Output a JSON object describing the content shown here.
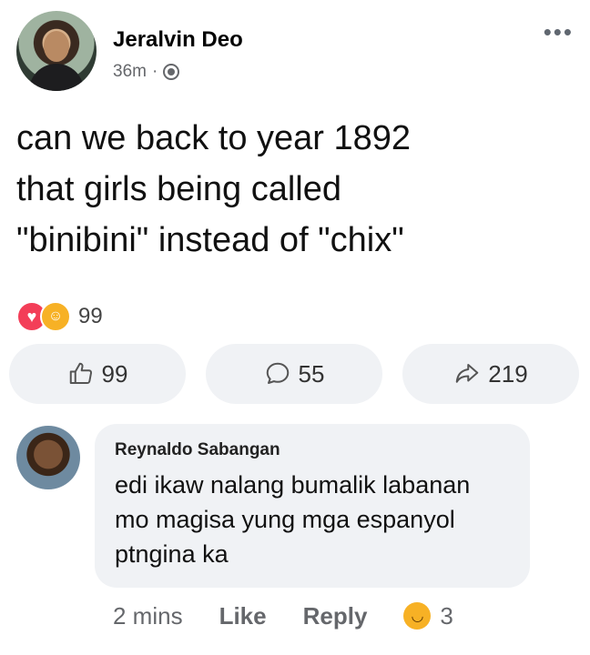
{
  "post": {
    "author": "Jeralvin Deo",
    "time": "36m",
    "separator": "·",
    "more_label": "•••",
    "text": "can we back to year 1892\nthat girls being called\n\"binibini\" instead of \"chix\"",
    "reaction_count": "99"
  },
  "actions": {
    "like_count": "99",
    "comment_count": "55",
    "share_count": "219"
  },
  "comment": {
    "author": "Reynaldo Sabangan",
    "text": "edi ikaw nalang bumalik labanan\nmo magisa yung mga espanyol\nptngina ka",
    "time": "2 mins",
    "like_label": "Like",
    "reply_label": "Reply",
    "reaction_count": "3"
  },
  "icons": {
    "love_reaction": "heart-icon",
    "care_reaction": "care-icon",
    "like": "thumbs-up-icon",
    "comment": "comment-bubble-icon",
    "share": "share-arrow-icon",
    "haha": "haha-icon",
    "privacy": "globe-icon"
  },
  "colors": {
    "love": "#f33e58",
    "care": "#f7b125",
    "muted_text": "#65676b",
    "button_bg": "#f0f2f5"
  }
}
